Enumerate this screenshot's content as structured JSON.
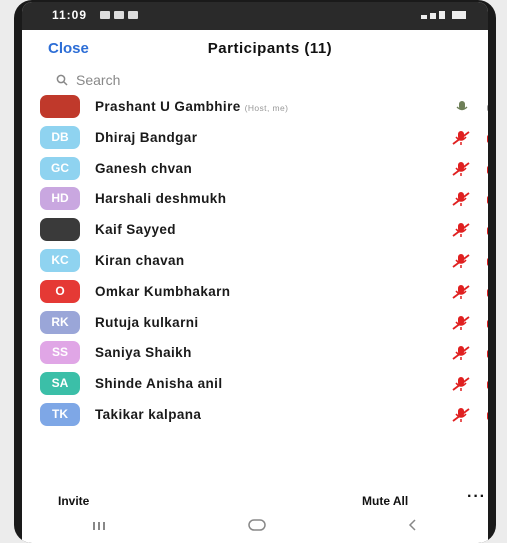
{
  "status_bar": {
    "time": "11:09"
  },
  "header": {
    "close_label": "Close",
    "title": "Participants (11)"
  },
  "search": {
    "placeholder": "Search"
  },
  "participants": [
    {
      "name": "Prashant U Gambhire",
      "tag": "(Host, me)",
      "initials": "",
      "avatar_color": "#c0392b",
      "muted": false
    },
    {
      "name": "Dhiraj Bandgar",
      "tag": "",
      "initials": "DB",
      "avatar_color": "#8fd3f0",
      "muted": true
    },
    {
      "name": "Ganesh chvan",
      "tag": "",
      "initials": "GC",
      "avatar_color": "#8fd3f0",
      "muted": true
    },
    {
      "name": "Harshali deshmukh",
      "tag": "",
      "initials": "HD",
      "avatar_color": "#c9a7e0",
      "muted": true
    },
    {
      "name": "Kaif Sayyed",
      "tag": "",
      "initials": "",
      "avatar_color": "#3a3a3a",
      "muted": true
    },
    {
      "name": "Kiran chavan",
      "tag": "",
      "initials": "KC",
      "avatar_color": "#8fd3f0",
      "muted": true
    },
    {
      "name": "Omkar Kumbhakarn",
      "tag": "",
      "initials": "O",
      "avatar_color": "#e53935",
      "muted": true
    },
    {
      "name": "Rutuja kulkarni",
      "tag": "",
      "initials": "RK",
      "avatar_color": "#9aa6d8",
      "muted": true
    },
    {
      "name": "Saniya Shaikh",
      "tag": "",
      "initials": "SS",
      "avatar_color": "#e0a6e6",
      "muted": true
    },
    {
      "name": "Shinde Anisha anil",
      "tag": "",
      "initials": "SA",
      "avatar_color": "#3bbfa8",
      "muted": true
    },
    {
      "name": "Takikar kalpana",
      "tag": "",
      "initials": "TK",
      "avatar_color": "#7ea7e6",
      "muted": true
    }
  ],
  "footer": {
    "invite_label": "Invite",
    "mute_all_label": "Mute All",
    "more_label": "···"
  },
  "nav": {
    "recents_label": "|||",
    "home_label": "○",
    "back_label": "<"
  },
  "colors": {
    "accent": "#2d6ed6",
    "muted_red": "#e02020"
  }
}
